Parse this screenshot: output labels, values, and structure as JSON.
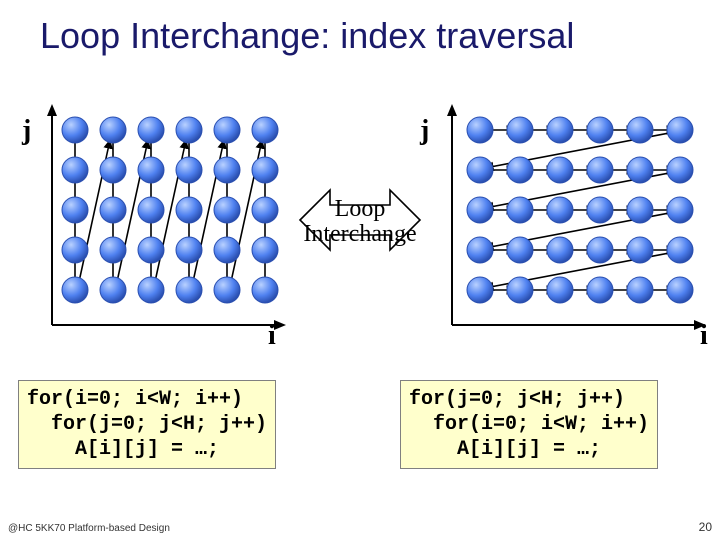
{
  "title": "Loop Interchange: index traversal",
  "axis": {
    "j": "j",
    "i": "i"
  },
  "center_label_line1": "Loop",
  "center_label_line2": "Interchange",
  "code_left": "for(i=0; i<W; i++)\n  for(j=0; j<H; j++)\n    A[i][j] = …;",
  "code_right": "for(j=0; j<H; j++)\n  for(i=0; i<W; i++)\n    A[i][j] = …;",
  "footer": "@HC 5KK70 Platform-based Design",
  "page": "20",
  "colors": {
    "title": "#1a1a6a",
    "node_fill": "#4f81f0",
    "node_stroke": "#2a4fb0",
    "axis": "#000000",
    "code_bg": "#ffffcc"
  },
  "chart_data": [
    {
      "type": "diagram",
      "name": "left-grid",
      "description": "5x6 grid of nodes with axes j (vertical) and i (horizontal); traversal order is column-major (j varies inner): path goes down each column then jumps to top of next column.",
      "cols": 6,
      "rows": 5,
      "traversal": "column-major"
    },
    {
      "type": "diagram",
      "name": "right-grid",
      "description": "5x6 grid of nodes with axes j (vertical) and i (horizontal); after loop interchange traversal is row-major (i varies inner): path goes right along each row then jumps to leftmost of next row.",
      "cols": 6,
      "rows": 5,
      "traversal": "row-major"
    }
  ]
}
